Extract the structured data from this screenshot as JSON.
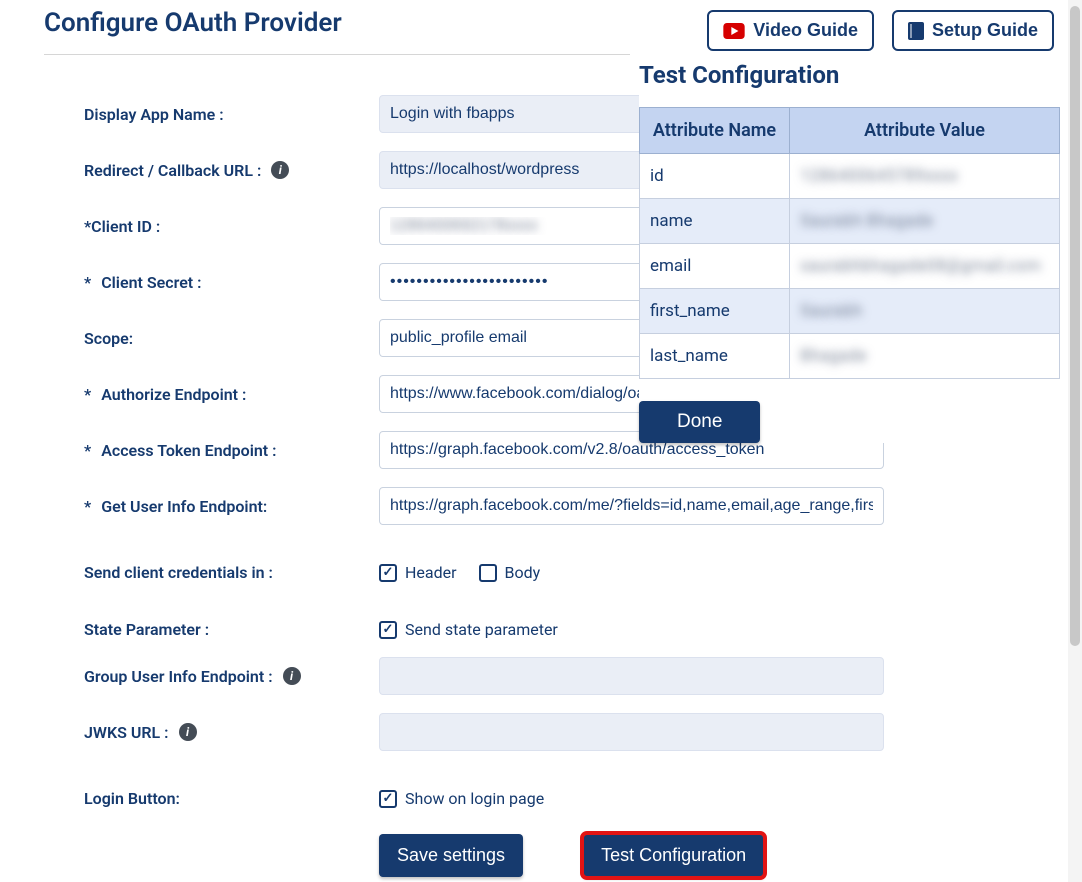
{
  "header": {
    "title": "Configure OAuth Provider",
    "videoGuide": "Video Guide",
    "setupGuide": "Setup Guide"
  },
  "fields": {
    "displayAppName": {
      "label": "Display App Name :",
      "value": "Login with fbapps"
    },
    "redirectUrl": {
      "label": "Redirect / Callback URL :",
      "value": "https://localhost/wordpress"
    },
    "clientId": {
      "label": "*Client ID :",
      "value": "1286400692178xxxx"
    },
    "clientSecret": {
      "labelPrefix": "*",
      "labelLink": "Client Secret :",
      "value": "••••••••••••••••••••••••"
    },
    "scope": {
      "label": "Scope:",
      "value": "public_profile email"
    },
    "authorizeEndpoint": {
      "labelPrefix": "*",
      "labelLink": "Authorize Endpoint :",
      "value": "https://www.facebook.com/dialog/oauth"
    },
    "accessTokenEndpoint": {
      "labelPrefix": "*",
      "labelLink": "Access Token Endpoint :",
      "value": "https://graph.facebook.com/v2.8/oauth/access_token"
    },
    "userInfoEndpoint": {
      "labelPrefix": "* ",
      "labelLink": "Get User Info Endpoint:",
      "value": "https://graph.facebook.com/me/?fields=id,name,email,age_range,first_name,last_name"
    },
    "sendCreds": {
      "label": "Send client credentials in :",
      "optHeader": "Header",
      "optBody": "Body"
    },
    "stateParam": {
      "label": "State Parameter :",
      "optSend": "Send state parameter"
    },
    "groupUserInfo": {
      "label": "Group User Info Endpoint :",
      "value": ""
    },
    "jwksUrl": {
      "label": "JWKS URL :",
      "value": ""
    },
    "loginButton": {
      "label": "Login Button:",
      "optShow": "Show on login page"
    }
  },
  "actions": {
    "save": "Save settings",
    "test": "Test Configuration"
  },
  "testPanel": {
    "title": "Test Configuration",
    "colName": "Attribute Name",
    "colValue": "Attribute Value",
    "rows": [
      {
        "name": "id",
        "value": "1286400645789xxxx"
      },
      {
        "name": "name",
        "value": "Saurabh Bhagade"
      },
      {
        "name": "email",
        "value": "saurabhbhagade08@gmail.com"
      },
      {
        "name": "first_name",
        "value": "Saurabh"
      },
      {
        "name": "last_name",
        "value": "Bhagade"
      }
    ],
    "done": "Done"
  }
}
